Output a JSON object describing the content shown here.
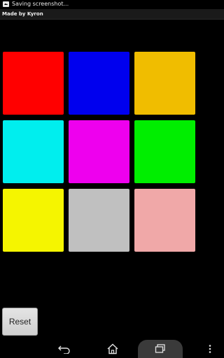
{
  "status_bar": {
    "notification_text": "Saving screenshot...",
    "icon": "screenshot-icon"
  },
  "title_bar": {
    "title": "Made by Kyron"
  },
  "grid": {
    "tiles": [
      {
        "name": "tile-red",
        "color": "#ff0000"
      },
      {
        "name": "tile-blue",
        "color": "#0000ee"
      },
      {
        "name": "tile-orange",
        "color": "#f0bd00"
      },
      {
        "name": "tile-cyan",
        "color": "#00eeee"
      },
      {
        "name": "tile-magenta",
        "color": "#ee00ee"
      },
      {
        "name": "tile-green",
        "color": "#00ee00"
      },
      {
        "name": "tile-yellow",
        "color": "#f5f500"
      },
      {
        "name": "tile-gray",
        "color": "#c0c0c0"
      },
      {
        "name": "tile-pink",
        "color": "#f0a8a8"
      }
    ]
  },
  "reset_button": {
    "label": "Reset"
  },
  "nav_bar": {
    "back_icon": "back-icon",
    "home_icon": "home-icon",
    "recents_icon": "recents-icon",
    "menu_icon": "menu-dots-icon"
  }
}
